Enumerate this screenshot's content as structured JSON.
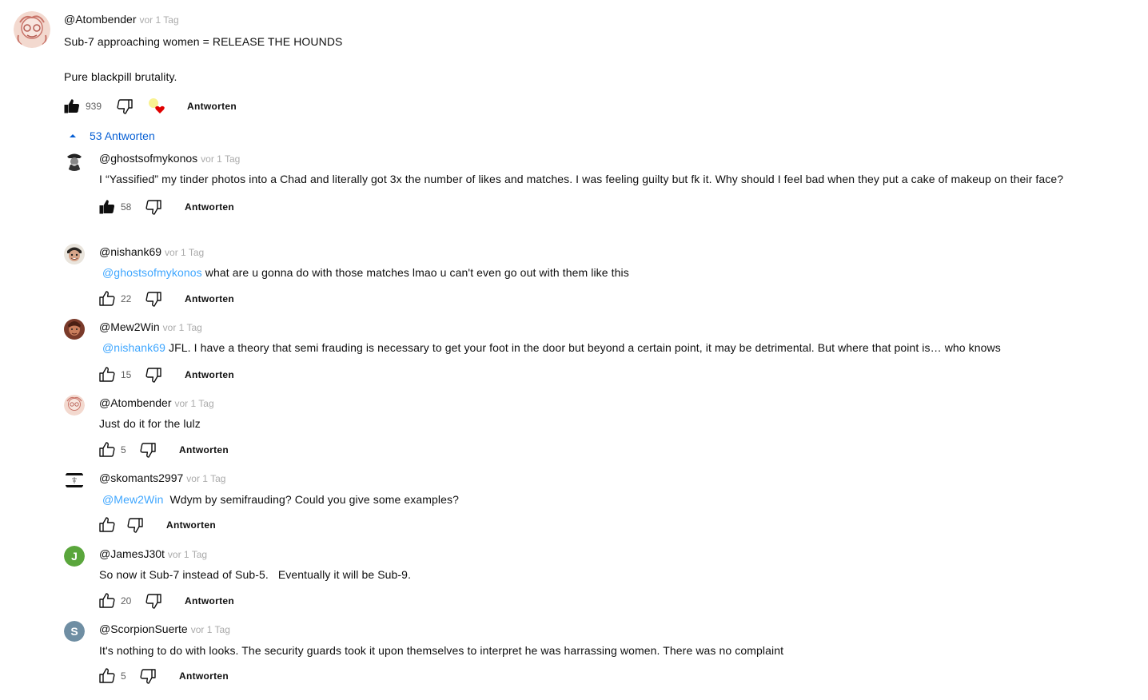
{
  "top_comment": {
    "author": "@Atombender",
    "time": "vor 1 Tag",
    "line1": "Sub-7 approaching women = RELEASE THE HOUNDS",
    "line2": "Pure blackpill brutality.",
    "likes": "939",
    "reply_label": "Antworten"
  },
  "replies_toggle": {
    "label": "53 Antworten"
  },
  "replies": [
    {
      "author": "@ghostsofmykonos",
      "time": "vor 1 Tag",
      "mention": "",
      "text": "I “Yassified” my tinder photos into a Chad and literally got 3x the number of likes and matches. I was feeling guilty but fk it. Why should I feel bad when they put a cake of makeup on their face?",
      "likes": "58",
      "liked": true,
      "reply_label": "Antworten"
    },
    {
      "author": "@nishank69",
      "time": "vor 1 Tag",
      "mention": "@ghostsofmykonos",
      "text": "what are u gonna do with those matches lmao u can't even go out with them like this",
      "likes": "22",
      "liked": false,
      "reply_label": "Antworten"
    },
    {
      "author": "@Mew2Win",
      "time": "vor 1 Tag",
      "mention": "@nishank69",
      "text": "JFL. I have a theory that semi frauding is necessary to get your foot in the door but beyond a certain point, it may be detrimental. But where that point is… who knows",
      "likes": "15",
      "liked": false,
      "reply_label": "Antworten"
    },
    {
      "author": "@Atombender",
      "time": "vor 1 Tag",
      "mention": "",
      "text": "Just do it for the lulz",
      "likes": "5",
      "liked": false,
      "reply_label": "Antworten"
    },
    {
      "author": "@skomants2997",
      "time": "vor 1 Tag",
      "mention": "@Mew2Win",
      "text": "Wdym by semifrauding? Could you give some examples?",
      "likes": "",
      "liked": false,
      "reply_label": "Antworten"
    },
    {
      "author": "@JamesJ30t",
      "time": "vor 1 Tag",
      "mention": "",
      "text": "So now it Sub-7 instead of Sub-5.   Eventually it will be Sub-9.",
      "likes": "20",
      "liked": false,
      "reply_label": "Antworten",
      "avatar_letter": "J",
      "avatar_color": "#5aa63c"
    },
    {
      "author": "@ScorpionSuerte",
      "time": "vor 1 Tag",
      "mention": "",
      "text": "It's nothing to do with looks. The security guards took it upon themselves to interpret he was harrassing women. There was no complaint",
      "likes": "5",
      "liked": false,
      "reply_label": "Antworten",
      "avatar_letter": "S",
      "avatar_color": "#6f8ea3"
    }
  ],
  "colors": {
    "link": "#065fd4",
    "mention": "#3ea6ff",
    "muted": "#aaaaaa",
    "heart": "#e00000"
  }
}
